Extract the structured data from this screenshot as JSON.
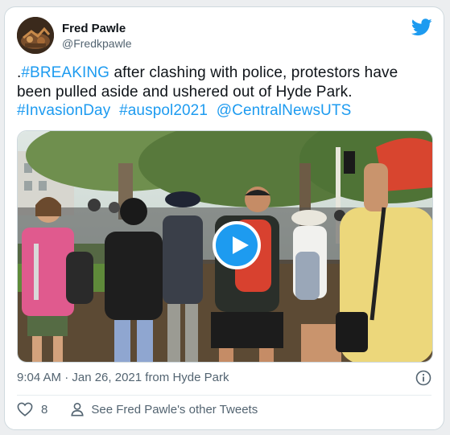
{
  "tweet": {
    "author_name": "Fred Pawle",
    "author_handle": "@Fredkpawle",
    "text_prefix": ".",
    "hashtag_breaking": "#BREAKING",
    "text_body": " after clashing with police, protestors have been pulled aside and ushered out of Hyde Park.",
    "hashtags": [
      "#InvasionDay",
      "#auspol2021",
      "@CentralNewsUTS"
    ],
    "timestamp": "9:04 AM · Jan 26, 2021 from Hyde Park",
    "like_count": "8",
    "other_tweets_label": "See Fred Pawle's other Tweets"
  },
  "icons": {
    "brand": "twitter-bird-icon",
    "play": "play-icon",
    "info": "info-icon",
    "like": "heart-icon",
    "profile": "person-icon"
  },
  "colors": {
    "accent": "#1d9bf0",
    "text": "#0f1419",
    "secondary": "#536471",
    "border": "#cfd9de"
  }
}
